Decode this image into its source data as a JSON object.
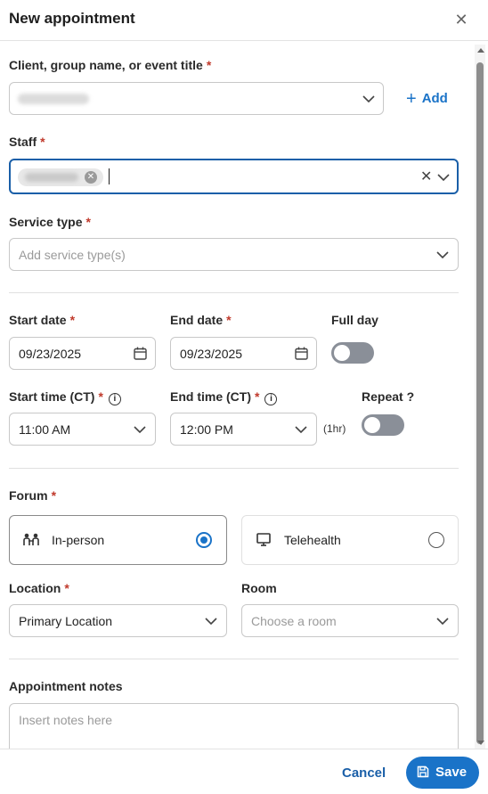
{
  "header": {
    "title": "New appointment",
    "close_icon": "close-icon"
  },
  "client": {
    "label": "Client, group name, or event title",
    "required": "*",
    "add_label": "Add"
  },
  "staff": {
    "label": "Staff",
    "required": "*"
  },
  "service": {
    "label": "Service type",
    "required": "*",
    "placeholder": "Add service type(s)"
  },
  "start_date": {
    "label": "Start date",
    "required": "*",
    "value": "09/23/2025"
  },
  "end_date": {
    "label": "End date",
    "required": "*",
    "value": "09/23/2025"
  },
  "full_day": {
    "label": "Full day",
    "on": false
  },
  "start_time": {
    "label": "Start time (CT)",
    "required": "*",
    "value": "11:00 AM"
  },
  "end_time": {
    "label": "End time (CT)",
    "required": "*",
    "value": "12:00 PM",
    "duration": "(1hr)"
  },
  "repeat": {
    "label": "Repeat ?",
    "on": false
  },
  "forum": {
    "label": "Forum",
    "required": "*",
    "options": [
      {
        "label": "In-person",
        "selected": true,
        "icon": "people-icon"
      },
      {
        "label": "Telehealth",
        "selected": false,
        "icon": "monitor-icon"
      }
    ]
  },
  "location": {
    "label": "Location",
    "required": "*",
    "value": "Primary Location"
  },
  "room": {
    "label": "Room",
    "placeholder": "Choose a room"
  },
  "notes": {
    "label": "Appointment notes",
    "placeholder": "Insert notes here"
  },
  "footer": {
    "cancel_label": "Cancel",
    "save_label": "Save"
  },
  "colors": {
    "accent": "#1a73c8",
    "required": "#c0392b",
    "focus_border": "#1a5fa8"
  }
}
